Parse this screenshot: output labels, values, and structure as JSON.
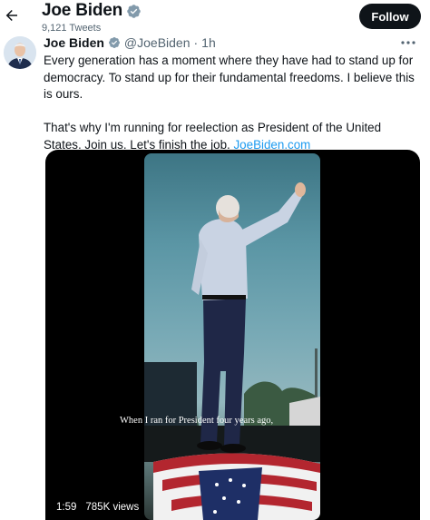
{
  "header": {
    "title": "Joe Biden",
    "tweet_count": "9,121 Tweets",
    "follow_label": "Follow"
  },
  "tweet": {
    "author_name": "Joe Biden",
    "handle": "@JoeBiden",
    "separator": "·",
    "time": "1h",
    "paragraph_1": "Every generation has a moment where they have had to stand up for democracy. To stand up for their fundamental freedoms. I believe this is ours.",
    "paragraph_2_text": "That's why I'm running for reelection as President of the United States. Join us. Let's finish the job. ",
    "paragraph_2_link": "JoeBiden.com"
  },
  "video": {
    "caption": "When I ran for President four years ago,",
    "duration": "1:59",
    "views": "785K views"
  },
  "icons": {
    "back": "arrow-left-icon",
    "verified": "verified-badge-icon",
    "more": "more-horizontal-icon"
  },
  "colors": {
    "accent": "#1d9bf0",
    "text": "#0f1419",
    "secondary": "#536471",
    "follow_bg": "#0f1419"
  }
}
